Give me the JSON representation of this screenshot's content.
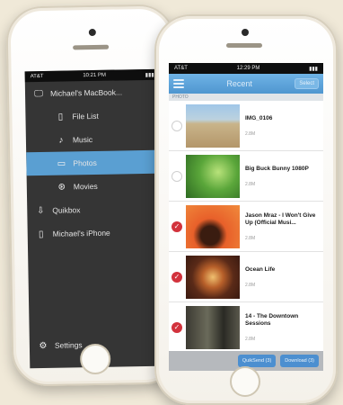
{
  "back_phone": {
    "status": {
      "carrier": "AT&T",
      "time": "10:21 PM"
    },
    "menu": {
      "computer": {
        "label": "Michael's MacBook...",
        "icon": "monitor-icon"
      },
      "sub_items": [
        {
          "label": "File List",
          "icon": "document-icon"
        },
        {
          "label": "Music",
          "icon": "music-note-icon"
        },
        {
          "label": "Photos",
          "icon": "photo-icon",
          "active": true
        },
        {
          "label": "Movies",
          "icon": "film-reel-icon"
        }
      ],
      "quikbox": {
        "label": "Quikbox",
        "icon": "inbox-tray-icon"
      },
      "iphone": {
        "label": "Michael's iPhone",
        "icon": "phone-icon"
      },
      "settings": {
        "label": "Settings",
        "icon": "gear-icon"
      }
    }
  },
  "front_phone": {
    "status": {
      "carrier": "AT&T",
      "time": "12:29 PM"
    },
    "nav": {
      "title": "Recent",
      "right_button": "Select"
    },
    "section": "PHOTO",
    "items": [
      {
        "title": "IMG_0106",
        "subtitle": "2.8M",
        "checked": false
      },
      {
        "title": "Big Buck Bunny 1080P",
        "subtitle": "2.8M",
        "checked": false
      },
      {
        "title": "Jason Mraz - I Won't Give Up (Official Musi...",
        "subtitle": "2.8M",
        "checked": true
      },
      {
        "title": "Ocean Life",
        "subtitle": "2.8M",
        "checked": true
      },
      {
        "title": "14 - The Downtown Sessions",
        "subtitle": "2.8M",
        "checked": true
      }
    ],
    "bottom": {
      "left_button": "QuikSend (3)",
      "right_button": "Download (3)"
    }
  },
  "colors": {
    "accent": "#5a9fd2",
    "check": "#d2323c",
    "menu_bg": "#353535"
  }
}
